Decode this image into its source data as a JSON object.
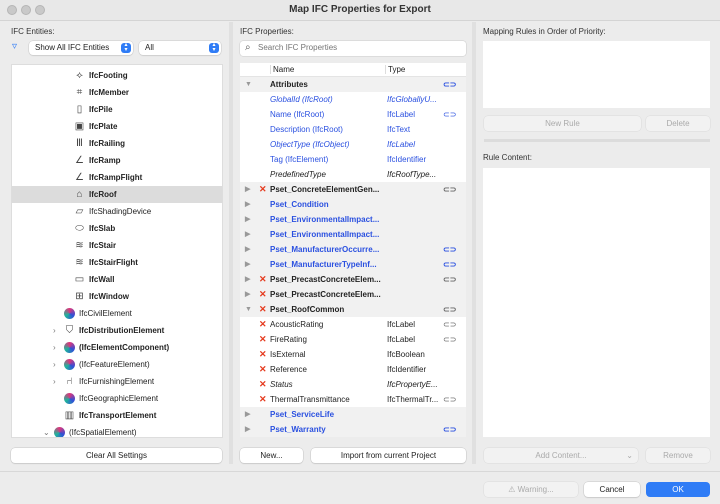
{
  "window": {
    "title": "Map IFC Properties for Export"
  },
  "left": {
    "label": "IFC Entities:",
    "filter_select": "Show All IFC Entities",
    "scope_select": "All",
    "items": [
      {
        "label": "IfcFooting",
        "bold": true,
        "depth": 2,
        "icon": "footing-icon"
      },
      {
        "label": "IfcMember",
        "bold": true,
        "depth": 2,
        "icon": "member-icon"
      },
      {
        "label": "IfcPile",
        "bold": true,
        "depth": 2,
        "icon": "pile-icon"
      },
      {
        "label": "IfcPlate",
        "bold": true,
        "depth": 2,
        "icon": "plate-icon"
      },
      {
        "label": "IfcRailing",
        "bold": true,
        "depth": 2,
        "icon": "railing-icon"
      },
      {
        "label": "IfcRamp",
        "bold": true,
        "depth": 2,
        "icon": "ramp-icon"
      },
      {
        "label": "IfcRampFlight",
        "bold": true,
        "depth": 2,
        "icon": "ramp-icon"
      },
      {
        "label": "IfcRoof",
        "bold": true,
        "depth": 2,
        "icon": "roof-icon",
        "selected": true
      },
      {
        "label": "IfcShadingDevice",
        "bold": false,
        "depth": 2,
        "icon": "shading-device-icon"
      },
      {
        "label": "IfcSlab",
        "bold": true,
        "depth": 2,
        "icon": "slab-icon"
      },
      {
        "label": "IfcStair",
        "bold": true,
        "depth": 2,
        "icon": "stair-icon"
      },
      {
        "label": "IfcStairFlight",
        "bold": true,
        "depth": 2,
        "icon": "stair-icon"
      },
      {
        "label": "IfcWall",
        "bold": true,
        "depth": 2,
        "icon": "wall-icon"
      },
      {
        "label": "IfcWindow",
        "bold": true,
        "depth": 2,
        "icon": "window-icon"
      },
      {
        "label": "IfcCivilElement",
        "bold": false,
        "depth": 1,
        "icon": "ifc-icon"
      },
      {
        "label": "IfcDistributionElement",
        "bold": true,
        "depth": 1,
        "icon": "distribution-icon",
        "chevron": ">"
      },
      {
        "label": "(IfcElementComponent)",
        "bold": true,
        "depth": 1,
        "icon": "ifc-icon",
        "chevron": ">"
      },
      {
        "label": "(IfcFeatureElement)",
        "bold": false,
        "depth": 1,
        "icon": "ifc-icon",
        "chevron": ">"
      },
      {
        "label": "IfcFurnishingElement",
        "bold": false,
        "depth": 1,
        "icon": "furnishing-icon",
        "chevron": ">"
      },
      {
        "label": "IfcGeographicElement",
        "bold": false,
        "depth": 1,
        "icon": "ifc-icon"
      },
      {
        "label": "IfcTransportElement",
        "bold": true,
        "depth": 1,
        "icon": "transport-icon"
      },
      {
        "label": "(IfcSpatialElement)",
        "bold": false,
        "depth": 0,
        "icon": "ifc-icon",
        "chevron": "v"
      }
    ],
    "clear_button": "Clear All Settings"
  },
  "middle": {
    "label": "IFC Properties:",
    "search_placeholder": "Search IFC Properties",
    "col_name": "Name",
    "col_type": "Type",
    "rows": [
      {
        "name": "Attributes",
        "type": "",
        "group": true,
        "tri": "▼",
        "x": false,
        "link": true,
        "style": ""
      },
      {
        "name": "GlobalId (IfcRoot)",
        "type": "IfcGloballyU...",
        "group": false,
        "x": false,
        "link": false,
        "style": "blue it"
      },
      {
        "name": "Name (IfcRoot)",
        "type": "IfcLabel",
        "group": false,
        "x": false,
        "link": true,
        "style": "blue"
      },
      {
        "name": "Description (IfcRoot)",
        "type": "IfcText",
        "group": false,
        "x": false,
        "link": false,
        "style": "blue"
      },
      {
        "name": "ObjectType (IfcObject)",
        "type": "IfcLabel",
        "group": false,
        "x": false,
        "link": false,
        "style": "blue it"
      },
      {
        "name": "Tag (IfcElement)",
        "type": "IfcIdentifier",
        "group": false,
        "x": false,
        "link": false,
        "style": "blue"
      },
      {
        "name": "PredefinedType",
        "type": "IfcRoofType...",
        "group": false,
        "x": false,
        "link": false,
        "style": "it"
      },
      {
        "name": "Pset_ConcreteElementGen...",
        "type": "",
        "group": true,
        "tri": "▶",
        "x": true,
        "link": true,
        "style": ""
      },
      {
        "name": "Pset_Condition",
        "type": "",
        "group": true,
        "tri": "▶",
        "x": false,
        "link": false,
        "style": "blue"
      },
      {
        "name": "Pset_EnvironmentalImpact...",
        "type": "",
        "group": true,
        "tri": "▶",
        "x": false,
        "link": false,
        "style": "blue"
      },
      {
        "name": "Pset_EnvironmentalImpact...",
        "type": "",
        "group": true,
        "tri": "▶",
        "x": false,
        "link": false,
        "style": "blue"
      },
      {
        "name": "Pset_ManufacturerOccurre...",
        "type": "",
        "group": true,
        "tri": "▶",
        "x": false,
        "link": true,
        "style": "blue"
      },
      {
        "name": "Pset_ManufacturerTypeInf...",
        "type": "",
        "group": true,
        "tri": "▶",
        "x": false,
        "link": true,
        "style": "blue"
      },
      {
        "name": "Pset_PrecastConcreteElem...",
        "type": "",
        "group": true,
        "tri": "▶",
        "x": true,
        "link": true,
        "style": ""
      },
      {
        "name": "Pset_PrecastConcreteElem...",
        "type": "",
        "group": true,
        "tri": "▶",
        "x": true,
        "link": false,
        "style": ""
      },
      {
        "name": "Pset_RoofCommon",
        "type": "",
        "group": true,
        "tri": "▼",
        "x": true,
        "link": true,
        "style": ""
      },
      {
        "name": "AcousticRating",
        "type": "IfcLabel",
        "group": false,
        "x": true,
        "link": true,
        "style": ""
      },
      {
        "name": "FireRating",
        "type": "IfcLabel",
        "group": false,
        "x": true,
        "link": true,
        "style": ""
      },
      {
        "name": "IsExternal",
        "type": "IfcBoolean",
        "group": false,
        "x": true,
        "link": false,
        "style": ""
      },
      {
        "name": "Reference",
        "type": "IfcIdentifier",
        "group": false,
        "x": true,
        "link": false,
        "style": ""
      },
      {
        "name": "Status",
        "type": "IfcPropertyE...",
        "group": false,
        "x": true,
        "link": false,
        "style": "it"
      },
      {
        "name": "ThermalTransmittance",
        "type": "IfcThermalTr...",
        "group": false,
        "x": true,
        "link": true,
        "style": ""
      },
      {
        "name": "Pset_ServiceLife",
        "type": "",
        "group": true,
        "tri": "▶",
        "x": false,
        "link": false,
        "style": "blue"
      },
      {
        "name": "Pset_Warranty",
        "type": "",
        "group": true,
        "tri": "▶",
        "x": false,
        "link": true,
        "style": "blue"
      }
    ],
    "new_button": "New...",
    "import_button": "Import from current Project"
  },
  "right": {
    "rules_label": "Mapping Rules in Order of Priority:",
    "new_rule_button": "New Rule",
    "delete_button": "Delete",
    "content_label": "Rule Content:",
    "add_content_button": "Add Content...",
    "remove_button": "Remove"
  },
  "footer": {
    "warning_button": "Warning...",
    "cancel_button": "Cancel",
    "ok_button": "OK"
  },
  "colors": {
    "accent": "#2f7cf6",
    "error": "#e53a1e",
    "link_blue": "#2a50e0"
  }
}
